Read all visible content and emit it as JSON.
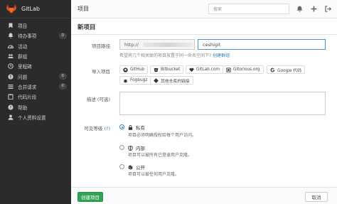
{
  "brand": {
    "name": "GitLab"
  },
  "sidebar": {
    "items": [
      {
        "label": "项目",
        "icon": "bookmark-icon"
      },
      {
        "label": "待办事项",
        "icon": "bell-icon",
        "badge": "0"
      },
      {
        "label": "活动",
        "icon": "dashboard-icon"
      },
      {
        "label": "群组",
        "icon": "group-icon"
      },
      {
        "label": "里程碑",
        "icon": "clock-icon"
      },
      {
        "label": "问题",
        "icon": "exclamation-icon",
        "badge": "0"
      },
      {
        "label": "合并请求",
        "icon": "tasks-icon",
        "badge": "0"
      },
      {
        "label": "代码片段",
        "icon": "clipboard-icon"
      },
      {
        "label": "帮助",
        "icon": "question-icon"
      },
      {
        "label": "个人资料设置",
        "icon": "user-icon"
      }
    ]
  },
  "header": {
    "title": "项目",
    "search_placeholder": "搜索"
  },
  "form": {
    "title": "新项目",
    "path_label": "项目路径",
    "path_prefix": "http://",
    "path_value": "ceshigit",
    "path_hint": "希望将几个相关联的项目放置于同一命名空间下?",
    "path_hint_link": "创建群组",
    "import_label": "导入项目",
    "import_sources": [
      "GitHub",
      "Bitbucket",
      "GitLab.com",
      "Gitorious.org",
      "Google 代码",
      "Fogbugz",
      "其他仓库的链接"
    ],
    "desc_label": "描述 (可选)",
    "visibility_label": "可见等级",
    "visibility_help": "(?)",
    "visibility": [
      {
        "name": "私有",
        "desc": "项目必须明确授权给每个用户访问。",
        "selected": true
      },
      {
        "name": "内部",
        "desc": "项目可以被所有已登录用户克隆。",
        "selected": false
      },
      {
        "name": "公开",
        "desc": "项目可以被任何用户克隆。",
        "selected": false
      }
    ],
    "create_label": "创建项目",
    "cancel_label": "取消"
  },
  "colors": {
    "sidebar_bg": "#2b2b2b",
    "accent": "#2d7fc1",
    "create": "#31a354",
    "logo": "#e24329"
  }
}
